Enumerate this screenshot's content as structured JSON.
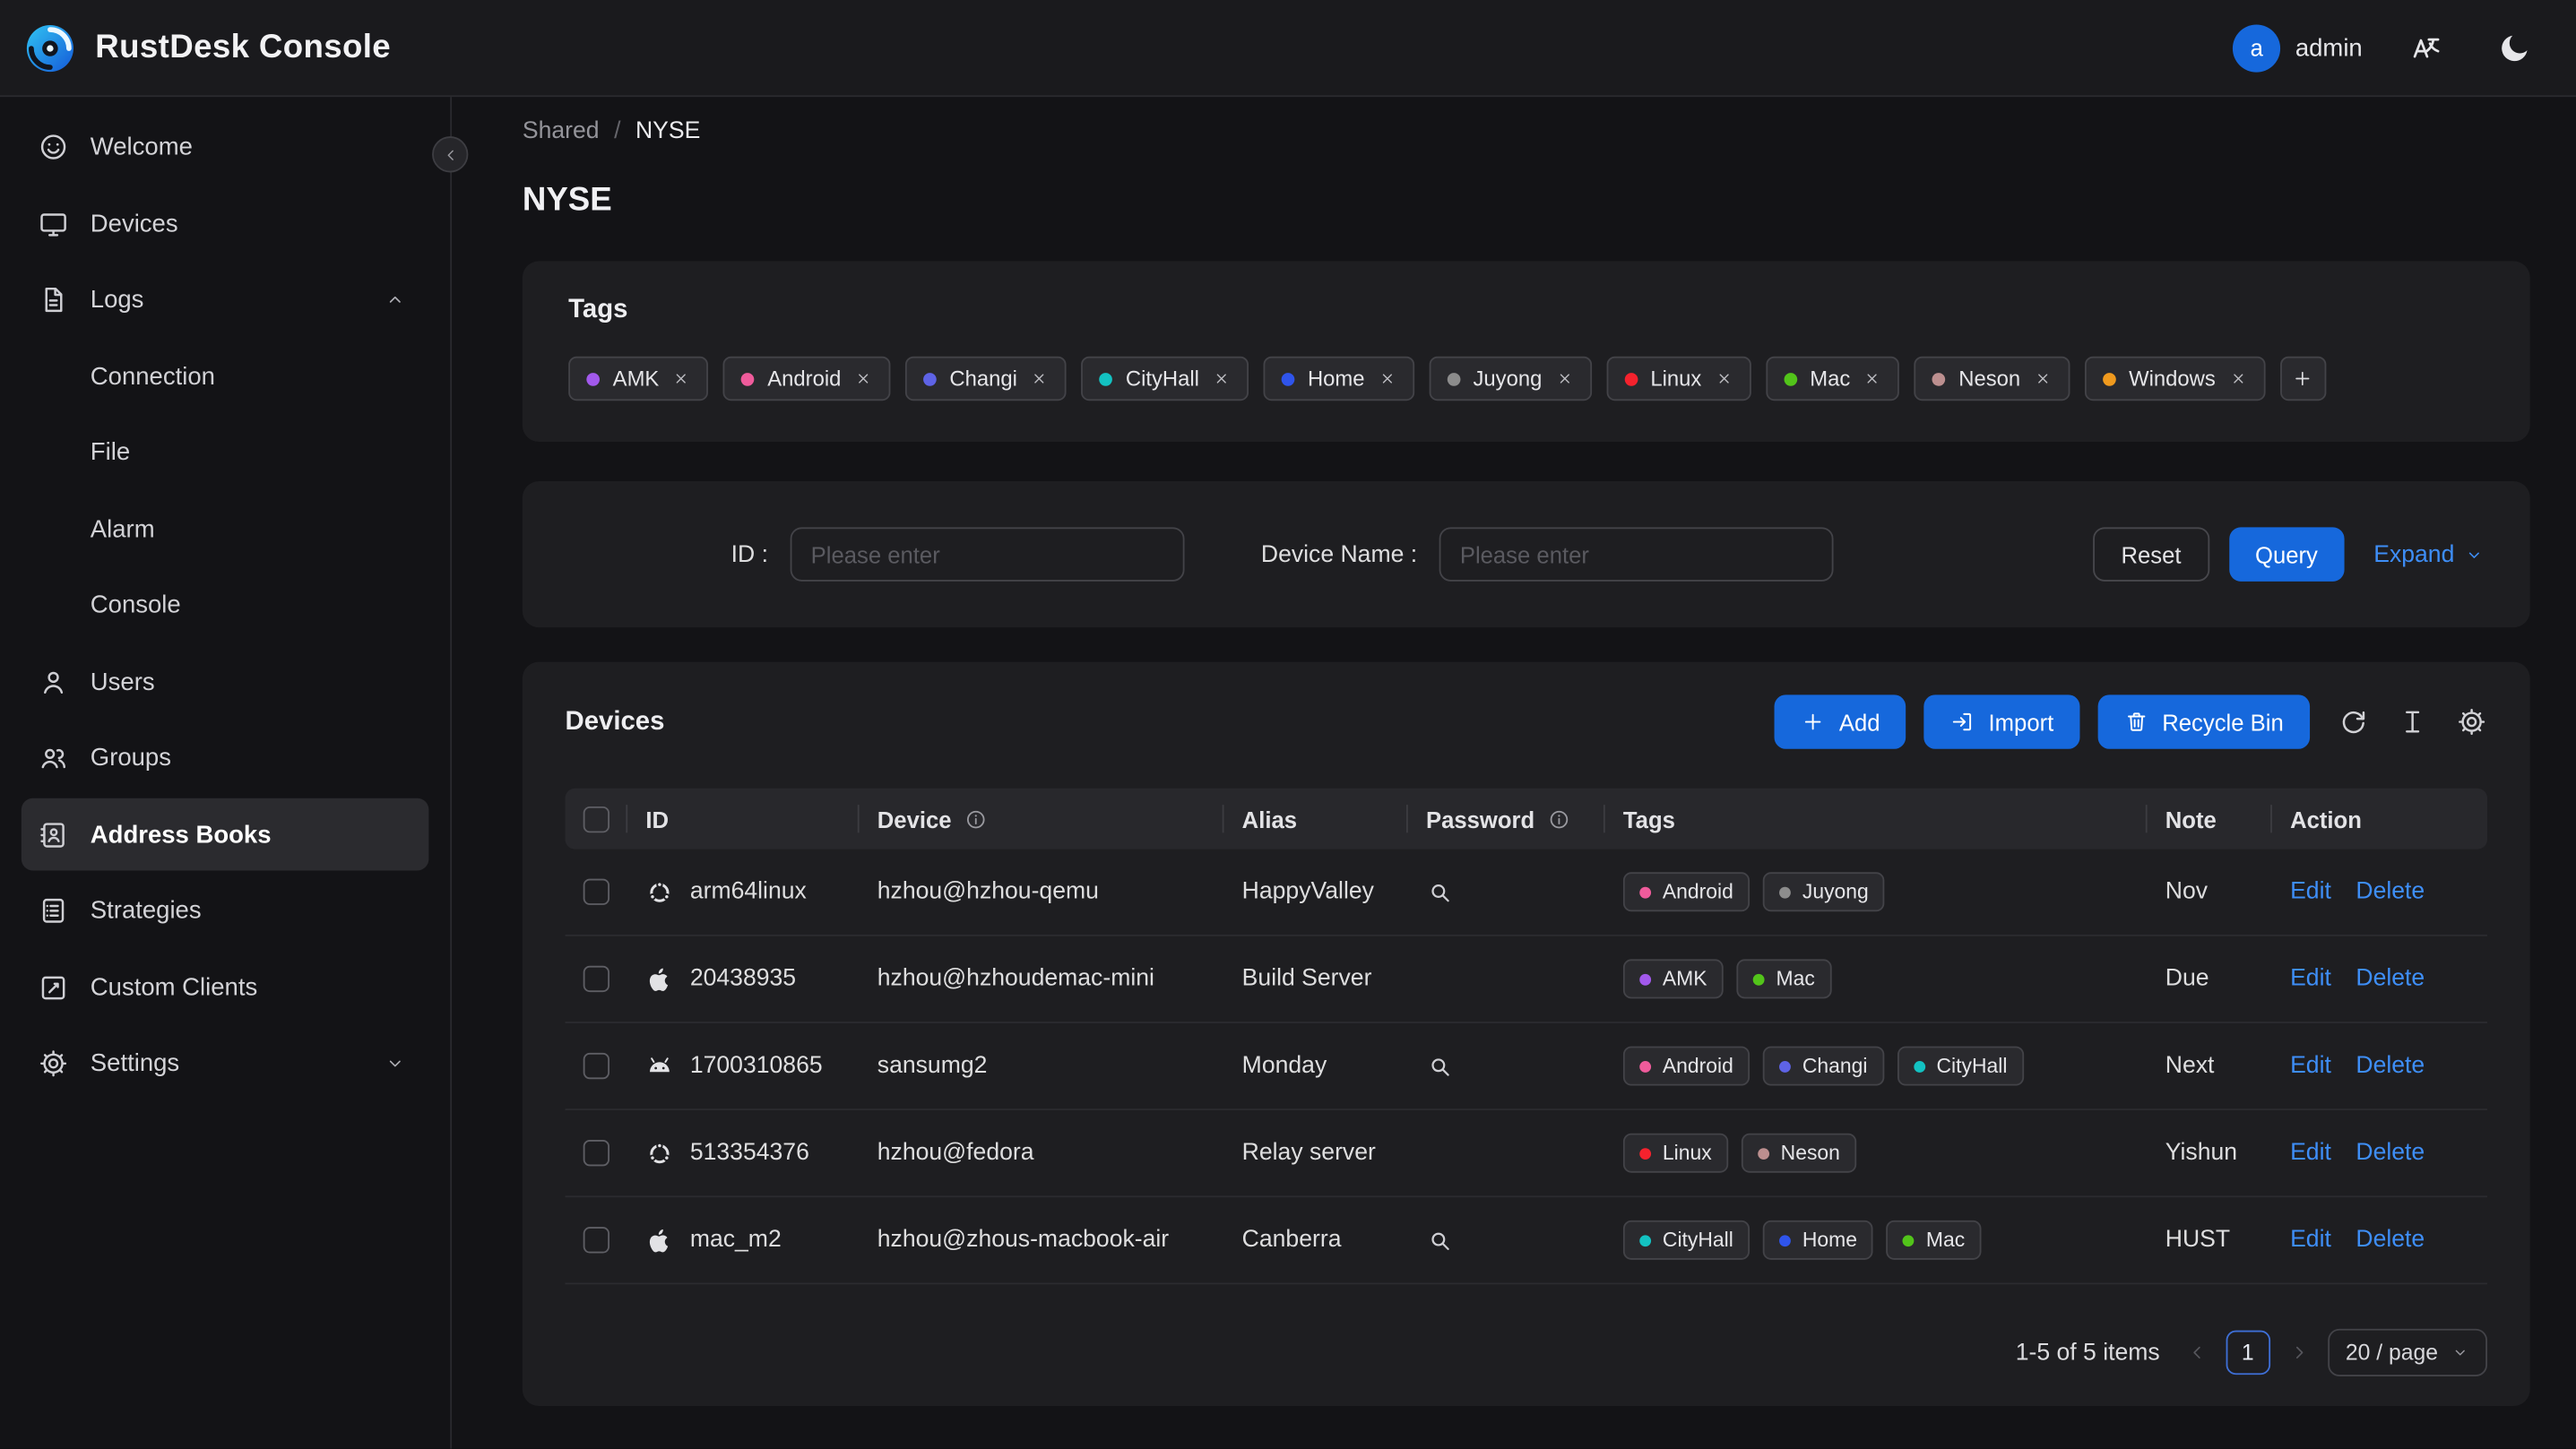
{
  "colors": {
    "primary": "#1668dc",
    "link": "#3e8ef7"
  },
  "header": {
    "app_title": "RustDesk Console",
    "logo_icon": "rustdesk-logo",
    "user": {
      "avatar_letter": "a",
      "name": "admin"
    },
    "action_icons": [
      "language-icon",
      "theme-toggle-moon-icon"
    ]
  },
  "sidebar": {
    "collapse_icon": "chevron-left",
    "items": [
      {
        "id": "welcome",
        "label": "Welcome",
        "icon": "smile"
      },
      {
        "id": "devices",
        "label": "Devices",
        "icon": "monitor"
      },
      {
        "id": "logs",
        "label": "Logs",
        "icon": "document",
        "chevron": "up",
        "children": [
          {
            "id": "connection",
            "label": "Connection"
          },
          {
            "id": "file",
            "label": "File"
          },
          {
            "id": "alarm",
            "label": "Alarm"
          },
          {
            "id": "console",
            "label": "Console"
          }
        ]
      },
      {
        "id": "users",
        "label": "Users",
        "icon": "user"
      },
      {
        "id": "groups",
        "label": "Groups",
        "icon": "group"
      },
      {
        "id": "address-books",
        "label": "Address Books",
        "icon": "address-book",
        "active": true
      },
      {
        "id": "strategies",
        "label": "Strategies",
        "icon": "strategy"
      },
      {
        "id": "custom-clients",
        "label": "Custom Clients",
        "icon": "custom-client"
      },
      {
        "id": "settings",
        "label": "Settings",
        "icon": "gear",
        "chevron": "down"
      }
    ]
  },
  "breadcrumb": {
    "parent": "Shared",
    "separator": "/",
    "current": "NYSE"
  },
  "page_title": "NYSE",
  "tag_colors": {
    "AMK": "#a259ec",
    "Android": "#ef5b9b",
    "Changi": "#5e63e6",
    "CityHall": "#13c2c2",
    "Home": "#2f54eb",
    "Juyong": "#8c8c8c",
    "Linux": "#f5222d",
    "Mac": "#52c41a",
    "Neson": "#bc8f8f",
    "Windows": "#f09a1e"
  },
  "tags_card": {
    "title": "Tags",
    "tags": [
      "AMK",
      "Android",
      "Changi",
      "CityHall",
      "Home",
      "Juyong",
      "Linux",
      "Mac",
      "Neson",
      "Windows"
    ],
    "remove_icon": "close-x-icon",
    "add_button_icon": "plus-icon"
  },
  "filter": {
    "id_label": "ID :",
    "id_placeholder": "Please enter",
    "device_name_label": "Device Name :",
    "device_name_placeholder": "Please enter",
    "reset_label": "Reset",
    "query_label": "Query",
    "expand_label": "Expand"
  },
  "devices": {
    "title": "Devices",
    "toolbar": {
      "add_label": "Add",
      "import_label": "Import",
      "recycle_bin_label": "Recycle Bin",
      "icon_buttons": [
        "refresh-icon",
        "row-height-icon",
        "table-settings-gear-icon"
      ]
    },
    "table": {
      "columns": [
        {
          "key": "id",
          "label": "ID"
        },
        {
          "key": "device",
          "label": "Device",
          "info": true
        },
        {
          "key": "alias",
          "label": "Alias"
        },
        {
          "key": "password",
          "label": "Password",
          "info": true
        },
        {
          "key": "tags",
          "label": "Tags"
        },
        {
          "key": "note",
          "label": "Note"
        },
        {
          "key": "action",
          "label": "Action"
        }
      ],
      "edit_label": "Edit",
      "delete_label": "Delete",
      "password_icon": "search-magnifier-icon",
      "rows": [
        {
          "os": "linux",
          "id": "arm64linux",
          "device": "hzhou@hzhou-qemu",
          "alias": "HappyValley",
          "password_viewable": true,
          "tags": [
            "Android",
            "Juyong"
          ],
          "note": "Nov"
        },
        {
          "os": "apple",
          "id": "20438935",
          "device": "hzhou@hzhoudemac-mini",
          "alias": "Build Server",
          "password_viewable": false,
          "tags": [
            "AMK",
            "Mac"
          ],
          "note": "Due"
        },
        {
          "os": "android",
          "id": "1700310865",
          "device": "sansumg2",
          "alias": "Monday",
          "password_viewable": true,
          "tags": [
            "Android",
            "Changi",
            "CityHall"
          ],
          "note": "Next"
        },
        {
          "os": "linux",
          "id": "513354376",
          "device": "hzhou@fedora",
          "alias": "Relay server",
          "password_viewable": false,
          "tags": [
            "Linux",
            "Neson"
          ],
          "note": "Yishun"
        },
        {
          "os": "apple",
          "id": "mac_m2",
          "device": "hzhou@zhous-macbook-air",
          "alias": "Canberra",
          "password_viewable": true,
          "tags": [
            "CityHall",
            "Home",
            "Mac"
          ],
          "note": "HUST"
        }
      ]
    },
    "pagination": {
      "summary": "1-5 of 5 items",
      "page": "1",
      "page_size": "20 / page",
      "prev_icon": "chevron-left",
      "next_icon": "chevron-right"
    }
  }
}
